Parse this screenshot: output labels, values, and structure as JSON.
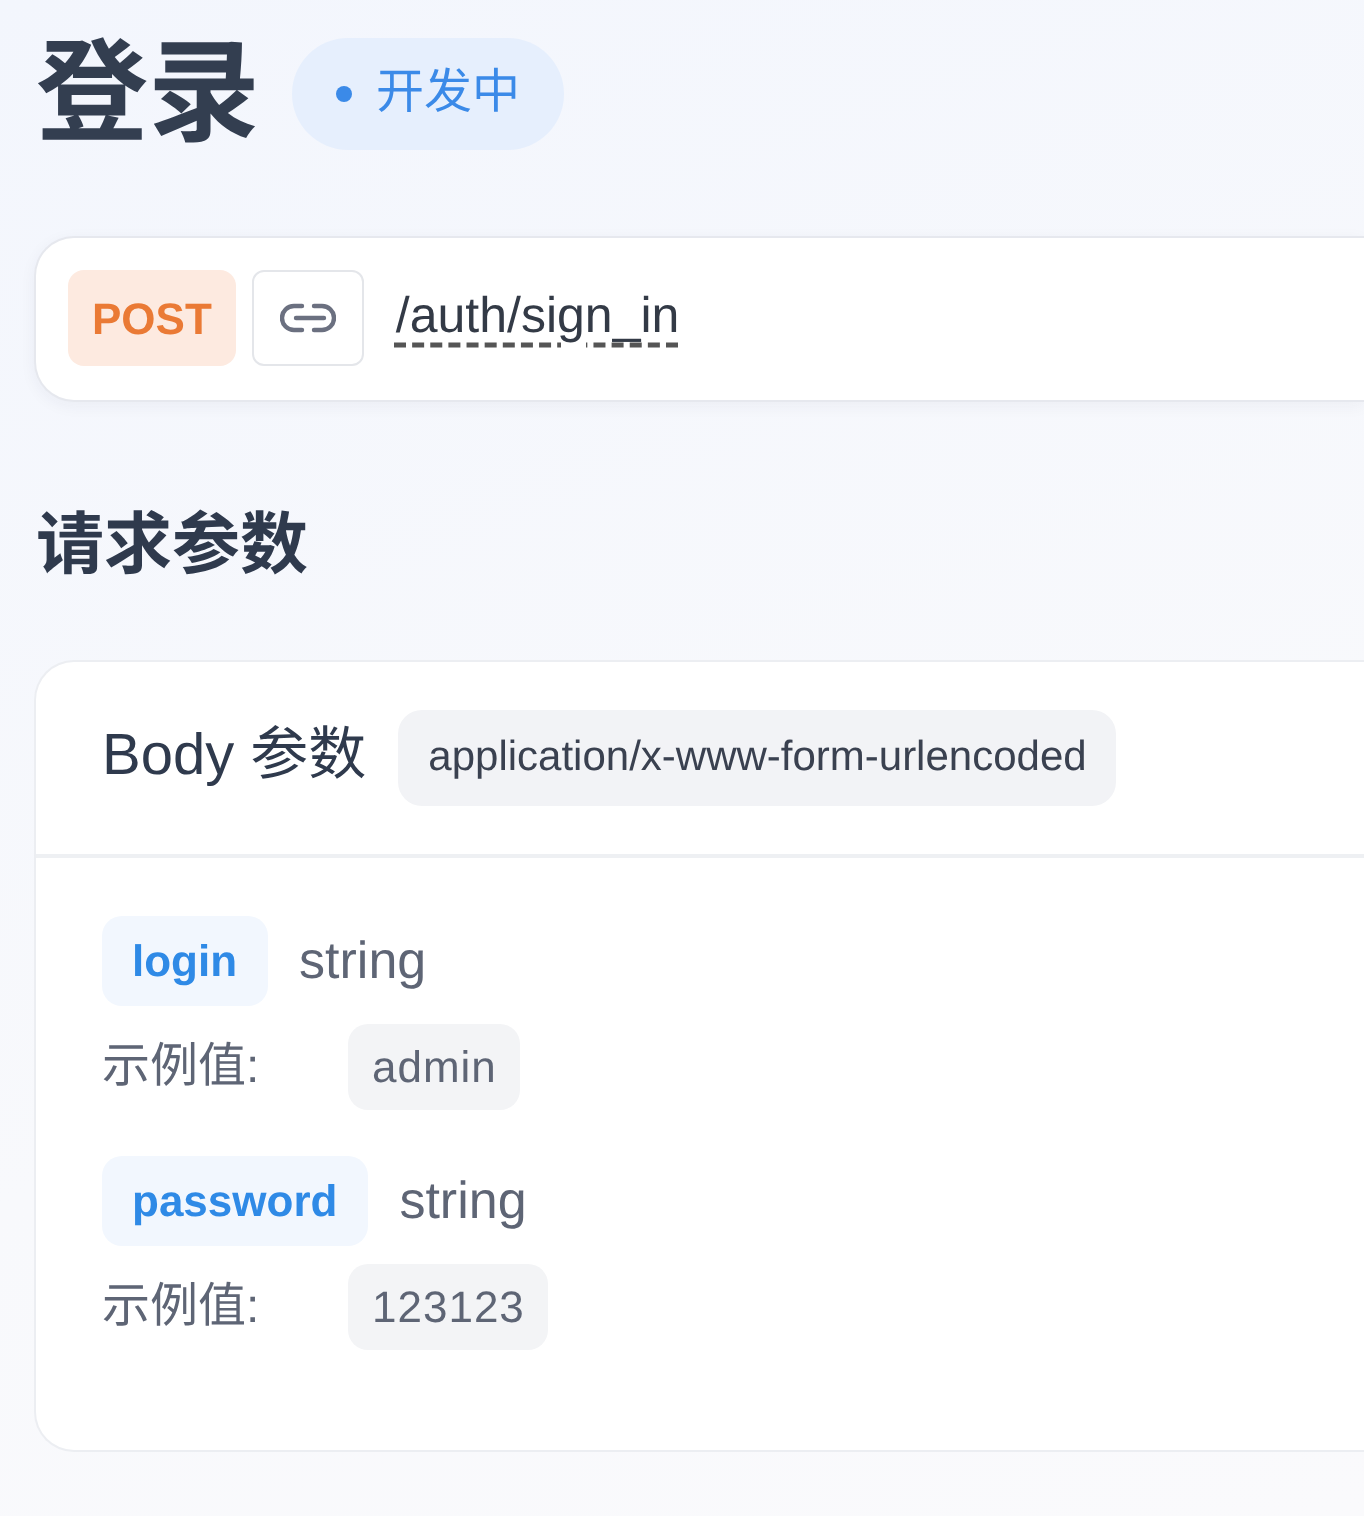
{
  "title": "登录",
  "status": {
    "label": "开发中"
  },
  "endpoint": {
    "method": "POST",
    "path": "/auth/sign_in"
  },
  "section_title": "请求参数",
  "body": {
    "title": "Body 参数",
    "content_type": "application/x-www-form-urlencoded",
    "params": [
      {
        "name": "login",
        "type": "string",
        "example_label": "示例值:",
        "example": "admin"
      },
      {
        "name": "password",
        "type": "string",
        "example_label": "示例值:",
        "example": "123123"
      }
    ]
  }
}
